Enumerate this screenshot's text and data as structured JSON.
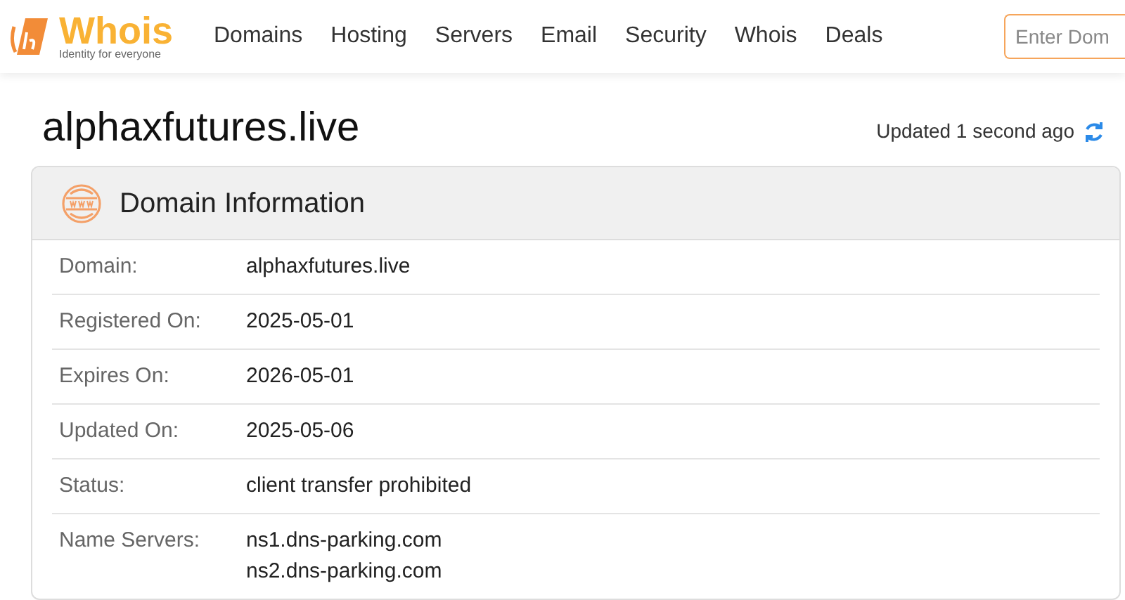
{
  "logo": {
    "name": "Whois",
    "tagline": "Identity for everyone"
  },
  "nav": [
    "Domains",
    "Hosting",
    "Servers",
    "Email",
    "Security",
    "Whois",
    "Deals"
  ],
  "search": {
    "placeholder": "Enter Dom"
  },
  "page_title": "alphaxfutures.live",
  "updated": "Updated 1 second ago",
  "card": {
    "title": "Domain Information",
    "rows": [
      {
        "label": "Domain:",
        "values": [
          "alphaxfutures.live"
        ]
      },
      {
        "label": "Registered On:",
        "values": [
          "2025-05-01"
        ]
      },
      {
        "label": "Expires On:",
        "values": [
          "2026-05-01"
        ]
      },
      {
        "label": "Updated On:",
        "values": [
          "2025-05-06"
        ]
      },
      {
        "label": "Status:",
        "values": [
          "client transfer prohibited"
        ]
      },
      {
        "label": "Name Servers:",
        "values": [
          "ns1.dns-parking.com",
          "ns2.dns-parking.com"
        ]
      }
    ]
  }
}
